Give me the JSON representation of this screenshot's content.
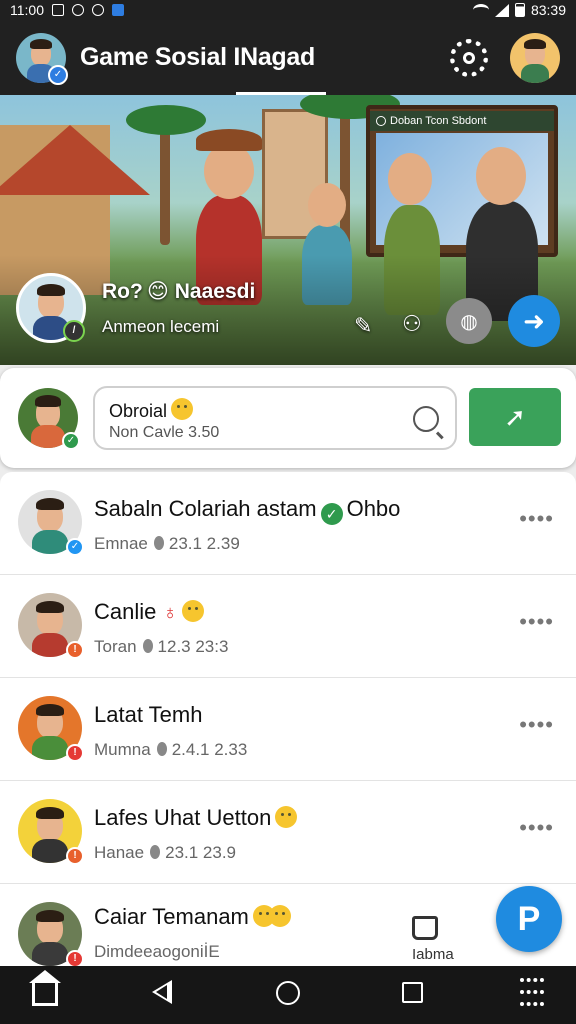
{
  "status_bar": {
    "time_left": "11:00",
    "time_right": "83:39"
  },
  "header": {
    "title": "Game Sosial INagad"
  },
  "banner": {
    "board_title": "Doban Tcon Sbdont",
    "profile_name": "Ro? 😊 Naaesdi",
    "profile_sub": "Anmeon lecemi"
  },
  "composer": {
    "value": "Obroial",
    "placeholder": "Non Cavle 3.50"
  },
  "list": [
    {
      "name": "Sabaln Colariah astam",
      "tag": "Ohbo",
      "user": "Emnae",
      "time": "23.1 2.39",
      "badge_color": "#2196f3"
    },
    {
      "name": "Canlie",
      "tag": "",
      "user": "Toran",
      "time": "12.3 23:3",
      "badge_color": "#e8602c"
    },
    {
      "name": "Latat Temh",
      "tag": "",
      "user": "Mumna",
      "time": "2.4.1 2.33",
      "badge_color": "#e53935"
    },
    {
      "name": "Lafes Uhat Uetton",
      "tag": "",
      "user": "Hanae",
      "time": "23.1 23.9",
      "badge_color": "#e8602c"
    },
    {
      "name": "Caiar Temanam",
      "tag": "",
      "user": "DimdeeaogoniİE",
      "time": "",
      "badge_color": "#e53935"
    }
  ],
  "group_label": "Iabma",
  "colors": {
    "accent_blue": "#1f8be0",
    "accent_green": "#3aa25a",
    "dark_bar": "#212121"
  }
}
